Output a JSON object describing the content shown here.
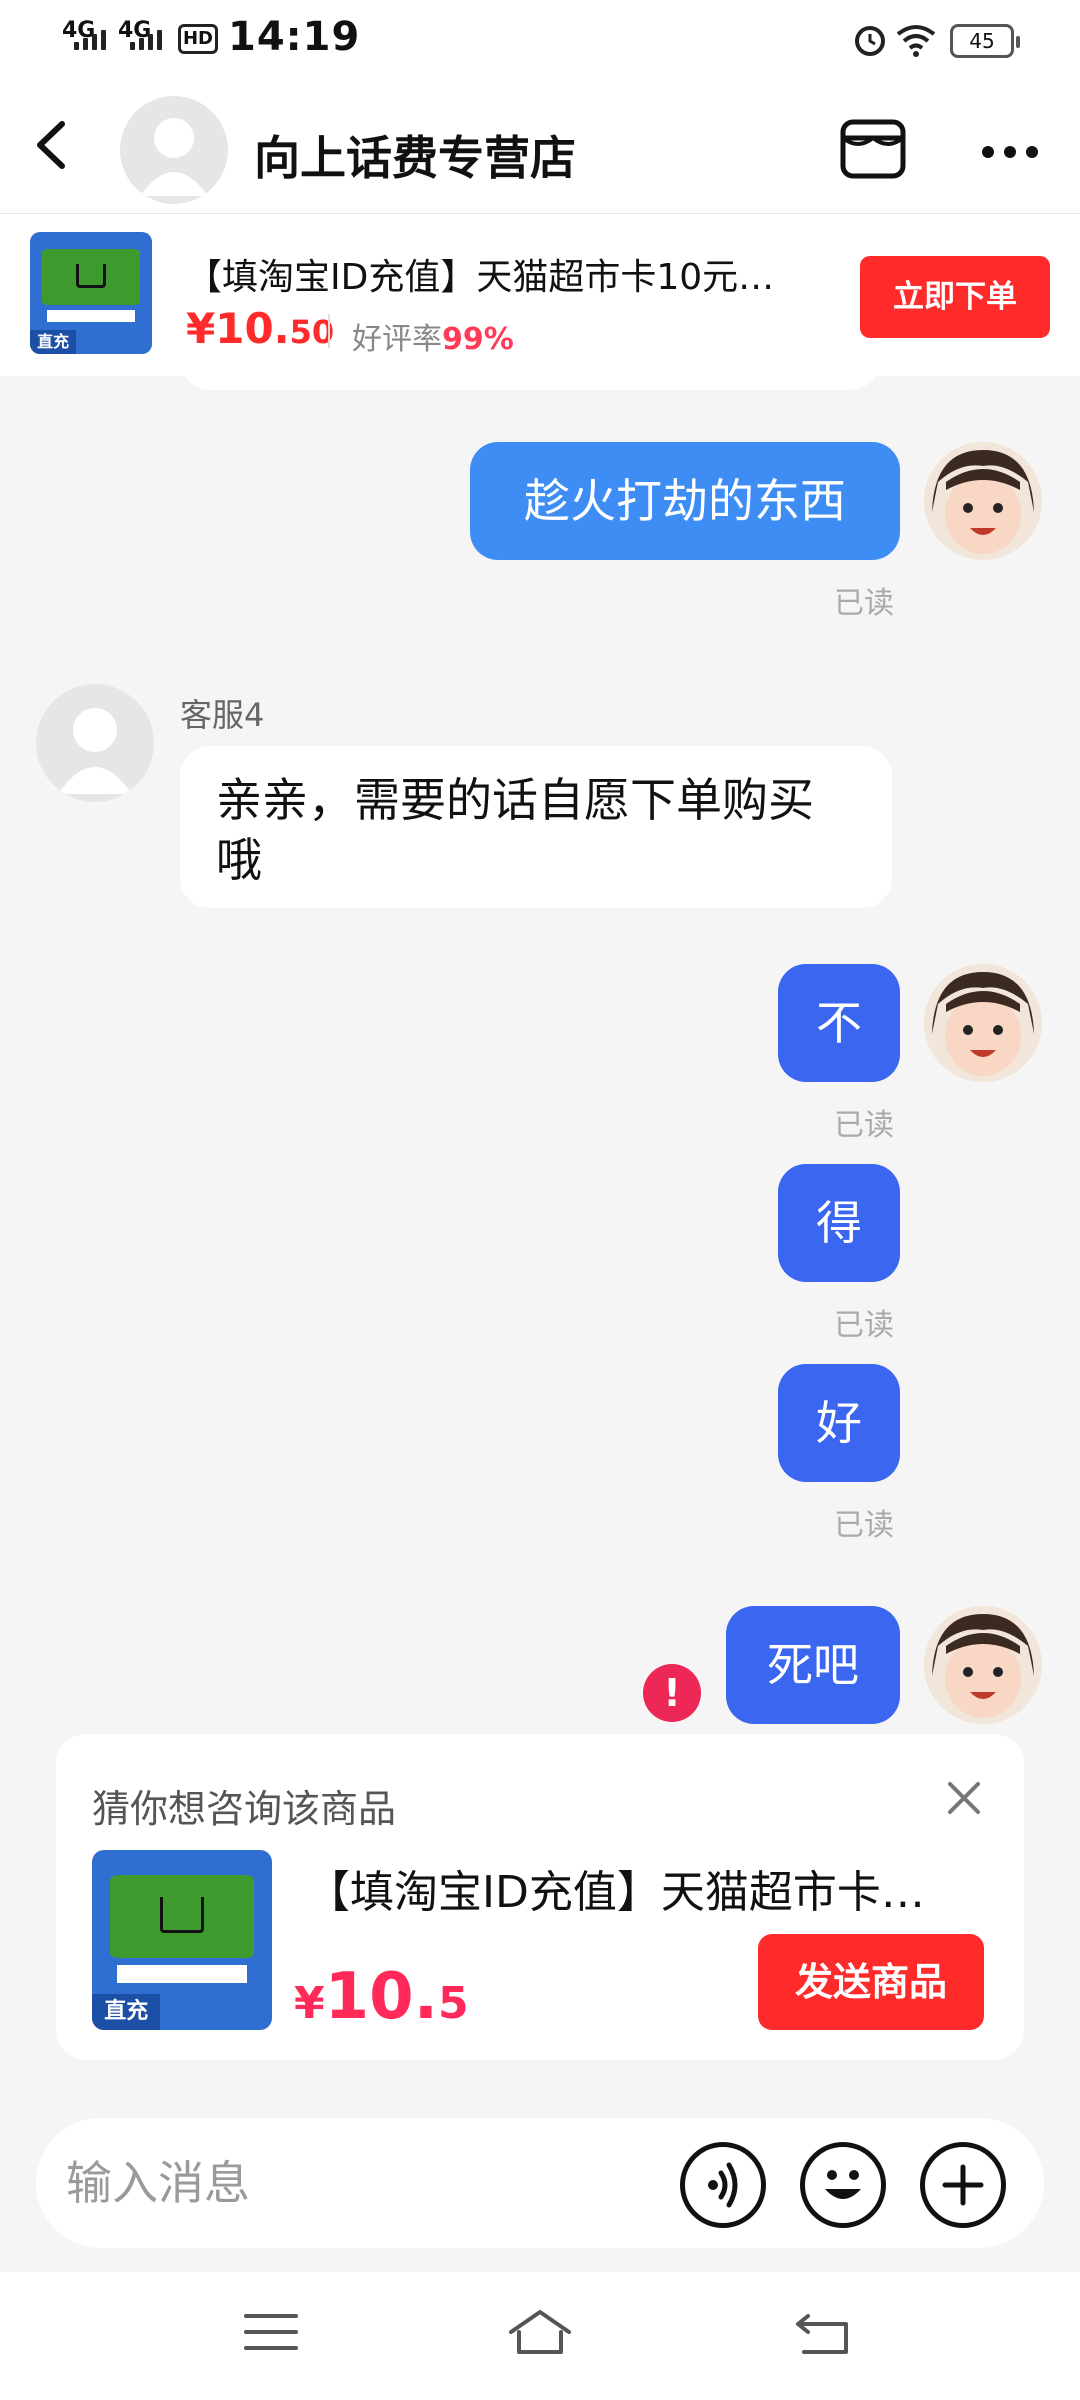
{
  "status_bar": {
    "network1": "4G",
    "network2": "4G",
    "hd": "HD",
    "time": "14:19",
    "battery": "45"
  },
  "header": {
    "shop_name": "向上话费专营店"
  },
  "product_strip": {
    "title": "【填淘宝ID充值】天猫超市卡10元天…",
    "price_int": "¥10.",
    "price_dec": "50",
    "rating_label": "好评率",
    "rating_value": "99%",
    "order_button": "立即下单"
  },
  "messages": [
    {
      "from": "me",
      "text": "趁火打劫的东西",
      "status": "已读"
    },
    {
      "from": "agent",
      "name": "客服4",
      "text": "亲亲，需要的话自愿下单购买哦"
    },
    {
      "from": "me",
      "text": "不",
      "status": "已读"
    },
    {
      "from": "me",
      "text": "得",
      "status": "已读"
    },
    {
      "from": "me",
      "text": "好",
      "status": "已读"
    },
    {
      "from": "me",
      "text": "死吧",
      "status": "failed"
    }
  ],
  "error_mark": "!",
  "suggestion": {
    "title": "猜你想咨询该商品",
    "product_name": "【填淘宝ID充值】天猫超市卡…",
    "currency": "¥",
    "price_int": "10.",
    "price_dec": "5",
    "send_button": "发送商品",
    "thumb_tag": "直充"
  },
  "input": {
    "placeholder": "输入消息"
  },
  "colors": {
    "accent_red": "#ff2a2a",
    "bubble_blue": "#3a66f0",
    "bubble_blue_light": "#3d8df5",
    "error_pink": "#ee2856",
    "background": "#f5f5f5"
  },
  "icons": {
    "back": "back-arrow-icon",
    "store": "store-icon",
    "more": "more-icon",
    "voice": "voice-icon",
    "emoji": "emoji-icon",
    "plus": "plus-icon",
    "close": "close-icon",
    "nav_menu": "menu-icon",
    "nav_home": "home-icon",
    "nav_back": "nav-back-icon"
  }
}
